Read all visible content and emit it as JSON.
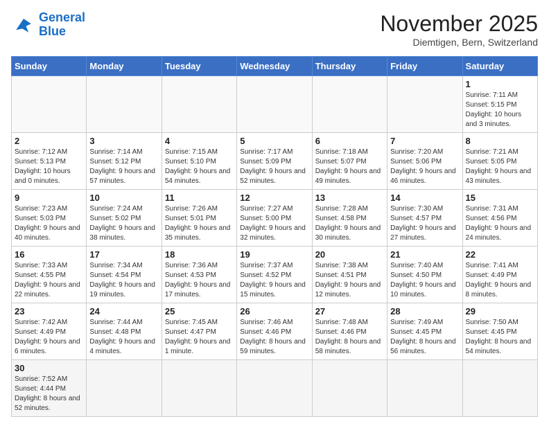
{
  "logo": {
    "line1": "General",
    "line2": "Blue"
  },
  "title": "November 2025",
  "subtitle": "Diemtigen, Bern, Switzerland",
  "headers": [
    "Sunday",
    "Monday",
    "Tuesday",
    "Wednesday",
    "Thursday",
    "Friday",
    "Saturday"
  ],
  "weeks": [
    [
      {
        "day": "",
        "info": ""
      },
      {
        "day": "",
        "info": ""
      },
      {
        "day": "",
        "info": ""
      },
      {
        "day": "",
        "info": ""
      },
      {
        "day": "",
        "info": ""
      },
      {
        "day": "",
        "info": ""
      },
      {
        "day": "1",
        "info": "Sunrise: 7:11 AM\nSunset: 5:15 PM\nDaylight: 10 hours\nand 3 minutes."
      }
    ],
    [
      {
        "day": "2",
        "info": "Sunrise: 7:12 AM\nSunset: 5:13 PM\nDaylight: 10 hours\nand 0 minutes."
      },
      {
        "day": "3",
        "info": "Sunrise: 7:14 AM\nSunset: 5:12 PM\nDaylight: 9 hours\nand 57 minutes."
      },
      {
        "day": "4",
        "info": "Sunrise: 7:15 AM\nSunset: 5:10 PM\nDaylight: 9 hours\nand 54 minutes."
      },
      {
        "day": "5",
        "info": "Sunrise: 7:17 AM\nSunset: 5:09 PM\nDaylight: 9 hours\nand 52 minutes."
      },
      {
        "day": "6",
        "info": "Sunrise: 7:18 AM\nSunset: 5:07 PM\nDaylight: 9 hours\nand 49 minutes."
      },
      {
        "day": "7",
        "info": "Sunrise: 7:20 AM\nSunset: 5:06 PM\nDaylight: 9 hours\nand 46 minutes."
      },
      {
        "day": "8",
        "info": "Sunrise: 7:21 AM\nSunset: 5:05 PM\nDaylight: 9 hours\nand 43 minutes."
      }
    ],
    [
      {
        "day": "9",
        "info": "Sunrise: 7:23 AM\nSunset: 5:03 PM\nDaylight: 9 hours\nand 40 minutes."
      },
      {
        "day": "10",
        "info": "Sunrise: 7:24 AM\nSunset: 5:02 PM\nDaylight: 9 hours\nand 38 minutes."
      },
      {
        "day": "11",
        "info": "Sunrise: 7:26 AM\nSunset: 5:01 PM\nDaylight: 9 hours\nand 35 minutes."
      },
      {
        "day": "12",
        "info": "Sunrise: 7:27 AM\nSunset: 5:00 PM\nDaylight: 9 hours\nand 32 minutes."
      },
      {
        "day": "13",
        "info": "Sunrise: 7:28 AM\nSunset: 4:58 PM\nDaylight: 9 hours\nand 30 minutes."
      },
      {
        "day": "14",
        "info": "Sunrise: 7:30 AM\nSunset: 4:57 PM\nDaylight: 9 hours\nand 27 minutes."
      },
      {
        "day": "15",
        "info": "Sunrise: 7:31 AM\nSunset: 4:56 PM\nDaylight: 9 hours\nand 24 minutes."
      }
    ],
    [
      {
        "day": "16",
        "info": "Sunrise: 7:33 AM\nSunset: 4:55 PM\nDaylight: 9 hours\nand 22 minutes."
      },
      {
        "day": "17",
        "info": "Sunrise: 7:34 AM\nSunset: 4:54 PM\nDaylight: 9 hours\nand 19 minutes."
      },
      {
        "day": "18",
        "info": "Sunrise: 7:36 AM\nSunset: 4:53 PM\nDaylight: 9 hours\nand 17 minutes."
      },
      {
        "day": "19",
        "info": "Sunrise: 7:37 AM\nSunset: 4:52 PM\nDaylight: 9 hours\nand 15 minutes."
      },
      {
        "day": "20",
        "info": "Sunrise: 7:38 AM\nSunset: 4:51 PM\nDaylight: 9 hours\nand 12 minutes."
      },
      {
        "day": "21",
        "info": "Sunrise: 7:40 AM\nSunset: 4:50 PM\nDaylight: 9 hours\nand 10 minutes."
      },
      {
        "day": "22",
        "info": "Sunrise: 7:41 AM\nSunset: 4:49 PM\nDaylight: 9 hours\nand 8 minutes."
      }
    ],
    [
      {
        "day": "23",
        "info": "Sunrise: 7:42 AM\nSunset: 4:49 PM\nDaylight: 9 hours\nand 6 minutes."
      },
      {
        "day": "24",
        "info": "Sunrise: 7:44 AM\nSunset: 4:48 PM\nDaylight: 9 hours\nand 4 minutes."
      },
      {
        "day": "25",
        "info": "Sunrise: 7:45 AM\nSunset: 4:47 PM\nDaylight: 9 hours\nand 1 minute."
      },
      {
        "day": "26",
        "info": "Sunrise: 7:46 AM\nSunset: 4:46 PM\nDaylight: 8 hours\nand 59 minutes."
      },
      {
        "day": "27",
        "info": "Sunrise: 7:48 AM\nSunset: 4:46 PM\nDaylight: 8 hours\nand 58 minutes."
      },
      {
        "day": "28",
        "info": "Sunrise: 7:49 AM\nSunset: 4:45 PM\nDaylight: 8 hours\nand 56 minutes."
      },
      {
        "day": "29",
        "info": "Sunrise: 7:50 AM\nSunset: 4:45 PM\nDaylight: 8 hours\nand 54 minutes."
      }
    ],
    [
      {
        "day": "30",
        "info": "Sunrise: 7:52 AM\nSunset: 4:44 PM\nDaylight: 8 hours\nand 52 minutes."
      },
      {
        "day": "",
        "info": ""
      },
      {
        "day": "",
        "info": ""
      },
      {
        "day": "",
        "info": ""
      },
      {
        "day": "",
        "info": ""
      },
      {
        "day": "",
        "info": ""
      },
      {
        "day": "",
        "info": ""
      }
    ]
  ]
}
